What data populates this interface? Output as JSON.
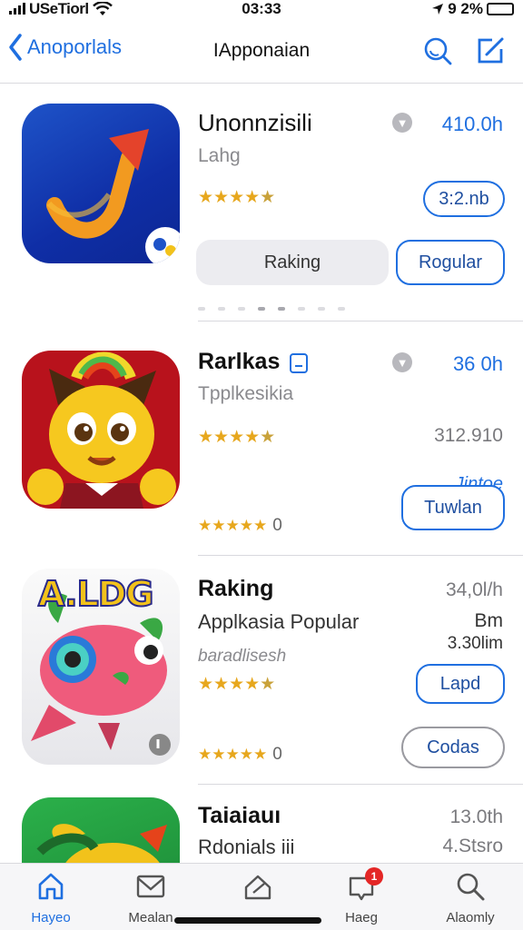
{
  "status": {
    "carrier": "USeTiorl",
    "time": "03:33",
    "battery_text": "9 2%",
    "battery_level": 0.22
  },
  "nav": {
    "back_label": "Anoporlals",
    "title": "IApponaian"
  },
  "apps": [
    {
      "name": "Unonnzisili",
      "subtitle": "Lahg",
      "size": "410.0h",
      "price_badge": "3:2.nb",
      "stars": "★★★★",
      "star_half": "★",
      "get_label": "Raking",
      "action_label": "Rogular"
    },
    {
      "name": "Rarlkas",
      "subtitle": "Tpplkesikia",
      "size": "36 0h",
      "secondary": "312.910",
      "stars": "★★★★",
      "star_half": "★",
      "small_stars": "★★★★★",
      "rating_count": "0",
      "button_top_label": "Jintoe",
      "button_label": "Tuwlan"
    },
    {
      "name": "Raking",
      "subtitle": "Applkasia Popular",
      "detail": "baradlisesh",
      "size_a": "34,0l/h",
      "size_b": "Bm",
      "size_c": "3.30lim",
      "stars": "★★★★",
      "star_half": "★",
      "small_stars": "★★★★★",
      "rating_count": "0",
      "button_label": "Lapd",
      "button2_label": "Codas",
      "icon_text": "A.LDG"
    },
    {
      "name": "Taiaiauı",
      "subtitle": "Rdonials iii",
      "size_a": "13.0th",
      "size_b": "4.Stsro"
    }
  ],
  "tabs": [
    {
      "label": "Hayeo",
      "icon": "house-icon"
    },
    {
      "label": "Mealan",
      "icon": "mail-icon"
    },
    {
      "label": "",
      "icon": "home-apps-icon"
    },
    {
      "label": "Haeg",
      "icon": "notification-icon",
      "badge": "1"
    },
    {
      "label": "Alaomly",
      "icon": "search-icon"
    }
  ],
  "colors": {
    "accent": "#1f6fe0",
    "star": "#e7a71d",
    "badge": "#e42626"
  }
}
